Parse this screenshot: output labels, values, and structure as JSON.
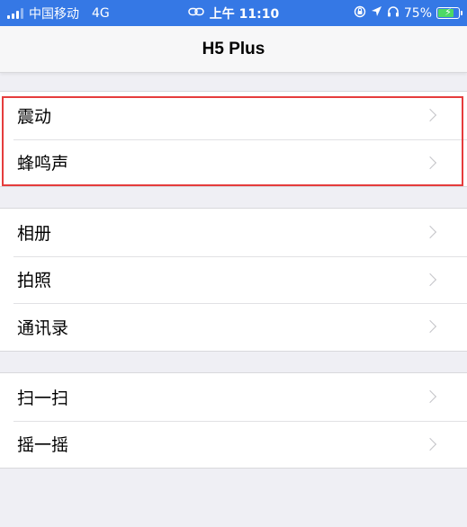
{
  "status_bar": {
    "carrier": "中国移动",
    "network": "4G",
    "time": "上午 11:10",
    "battery_percent": "75%",
    "battery_level": 0.75,
    "background_color": "#3578e5",
    "icons": [
      "signal-icon",
      "link-icon",
      "rotation-lock-icon",
      "location-icon",
      "headphones-icon",
      "battery-icon"
    ]
  },
  "nav_bar": {
    "title": "H5 Plus"
  },
  "groups": [
    {
      "items": [
        {
          "label": "震动"
        },
        {
          "label": "蜂鸣声"
        }
      ]
    },
    {
      "items": [
        {
          "label": "相册"
        },
        {
          "label": "拍照"
        },
        {
          "label": "通讯录"
        }
      ]
    },
    {
      "items": [
        {
          "label": "扫一扫"
        },
        {
          "label": "摇一摇"
        }
      ]
    }
  ],
  "highlight_color": "#e53c3c"
}
